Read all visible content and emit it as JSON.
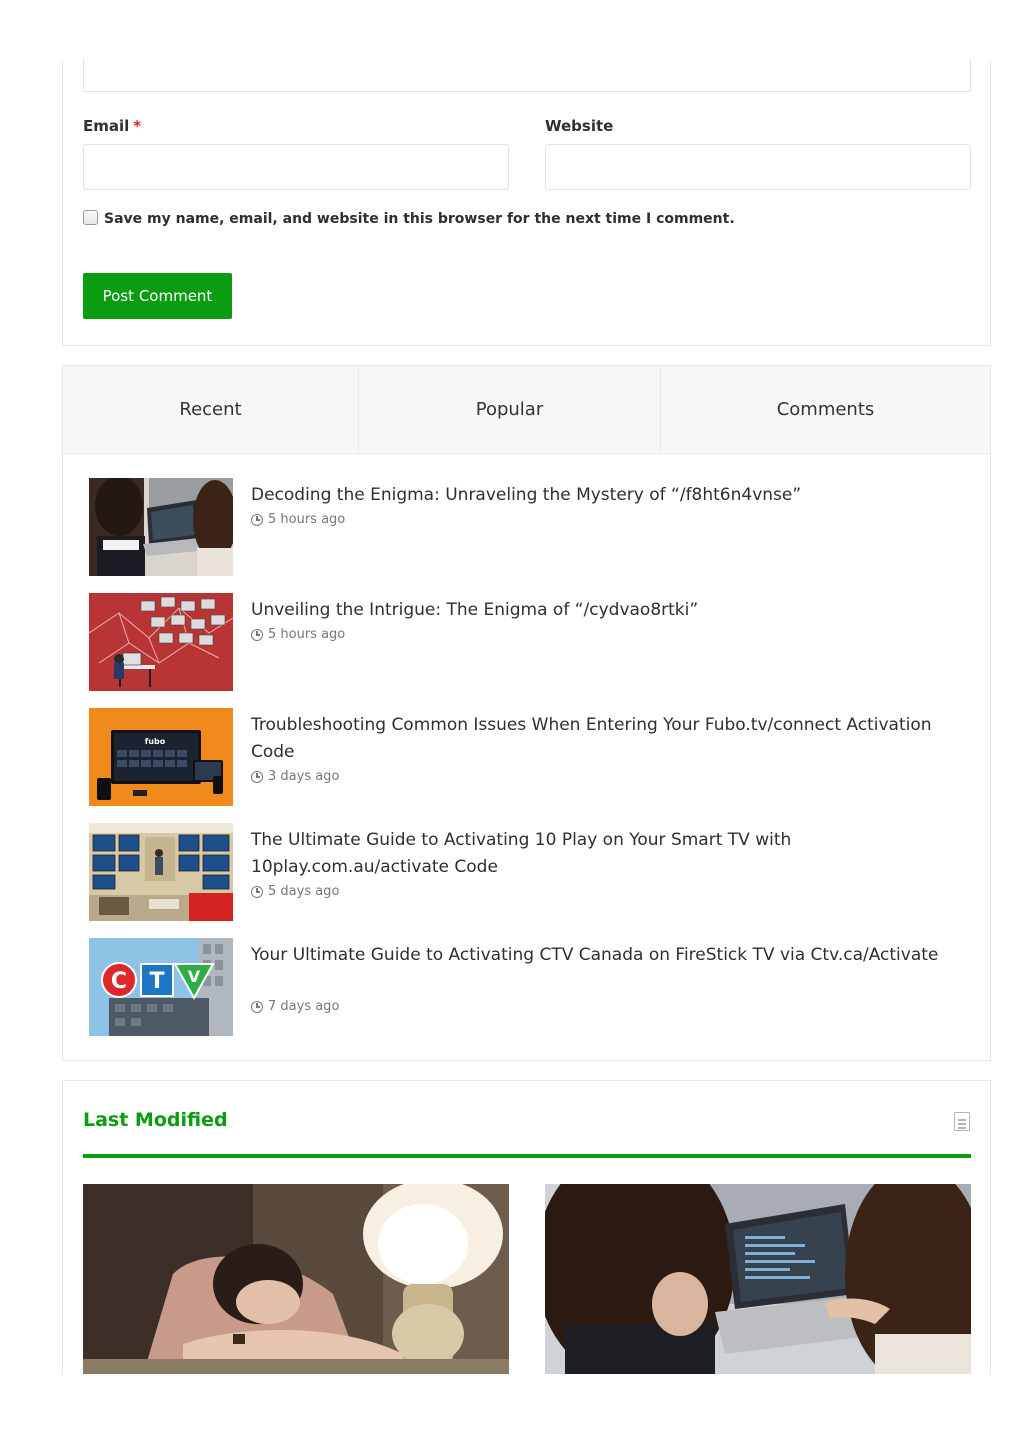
{
  "comment_form": {
    "email_label": "Email",
    "required_mark": "*",
    "website_label": "Website",
    "email_value": "",
    "website_value": "",
    "save_info_label": "Save my name, email, and website in this browser for the next time I comment.",
    "submit_label": "Post Comment"
  },
  "tabs": {
    "recent": "Recent",
    "popular": "Popular",
    "comments": "Comments"
  },
  "posts": [
    {
      "title": "Decoding the Enigma: Unraveling the Mystery of “/f8ht6n4vnse”",
      "time": "5 hours ago"
    },
    {
      "title": "Unveiling the Intrigue: The Enigma of “/cydvao8rtki”",
      "time": "5 hours ago"
    },
    {
      "title": "Troubleshooting Common Issues When Entering Your Fubo.tv/connect Activation Code",
      "time": "3 days ago"
    },
    {
      "title": "The Ultimate Guide to Activating 10 Play on Your Smart TV with 10play.com.au/activate Code",
      "time": "5 days ago"
    },
    {
      "title": "Your Ultimate Guide to Activating CTV Canada on FireStick TV via Ctv.ca/Activate",
      "time": "7 days ago"
    }
  ],
  "thumb_text": {
    "fubo_logo": "fubo",
    "ctv_c": "C",
    "ctv_t": "T",
    "ctv_v": "V"
  },
  "last_modified": {
    "title": "Last Modified"
  },
  "colors": {
    "accent_green": "#0b9c11",
    "required_red": "#e02020"
  },
  "icons": {
    "time": "clock-icon",
    "section": "document-icon"
  }
}
